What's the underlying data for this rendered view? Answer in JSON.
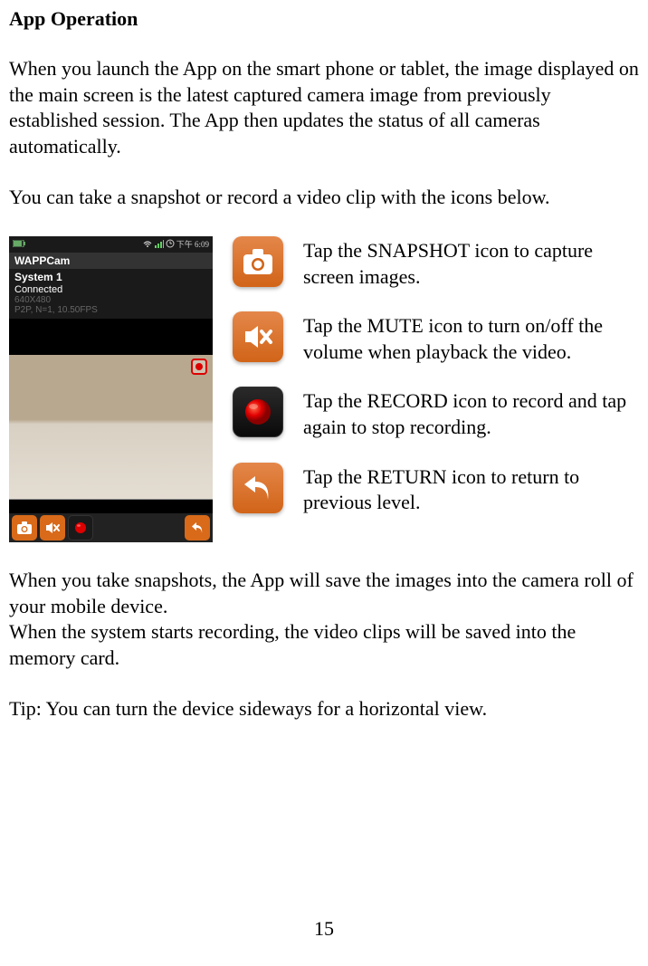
{
  "title": "App Operation",
  "para1": "When you launch the App on the smart phone or tablet, the image displayed on the main screen is the latest captured camera image from previously established session. The App then updates the status of all cameras automatically.",
  "para2": "You can take a snapshot or record a video clip with the icons below.",
  "phone": {
    "time": "下午 6:09",
    "app_title": "WAPPCam",
    "system": "System 1",
    "status": "Connected",
    "resolution": "640X480",
    "p2p": "P2P, N=1, 10.50FPS"
  },
  "icons": {
    "snapshot": "Tap the SNAPSHOT icon to capture screen images.",
    "mute": "Tap the MUTE icon to turn on/off the volume when playback the video.",
    "record": "Tap the RECORD icon to record and tap again to stop recording.",
    "return": "Tap the RETURN icon to return to previous level."
  },
  "para3a": "When you take snapshots, the App will save the images into the camera roll of your mobile device.",
  "para3b": "When the system starts recording, the video clips will be saved into the memory card.",
  "tip": "Tip: You can turn the device sideways for a horizontal view.",
  "page_number": "15"
}
